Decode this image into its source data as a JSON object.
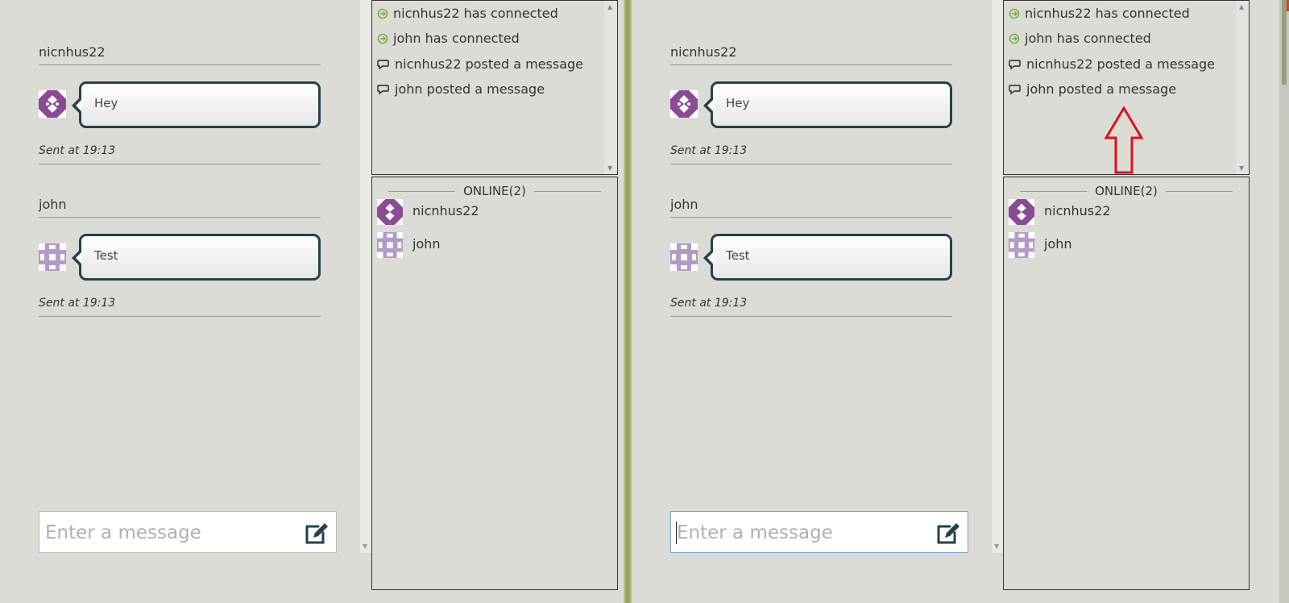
{
  "panes": [
    {
      "messages": [
        {
          "user": "nicnhus22",
          "text": "Hey",
          "sent": "Sent at 19:13"
        },
        {
          "user": "john",
          "text": "Test",
          "sent": "Sent at 19:13"
        }
      ],
      "input_placeholder": "Enter a message",
      "activity": [
        {
          "icon": "connect-icon",
          "text": "nicnhus22 has connected"
        },
        {
          "icon": "connect-icon",
          "text": "john has connected"
        },
        {
          "icon": "chat-bubble-icon",
          "text": "nicnhus22 posted a message"
        },
        {
          "icon": "chat-bubble-icon",
          "text": "john posted a message"
        }
      ],
      "online_title": "ONLINE(2)",
      "online_users": [
        "nicnhus22",
        "john"
      ]
    },
    {
      "messages": [
        {
          "user": "nicnhus22",
          "text": "Hey",
          "sent": "Sent at 19:13"
        },
        {
          "user": "john",
          "text": "Test",
          "sent": "Sent at 19:13"
        }
      ],
      "input_placeholder": "Enter a message",
      "activity": [
        {
          "icon": "connect-icon",
          "text": "nicnhus22 has connected"
        },
        {
          "icon": "connect-icon",
          "text": "john has connected"
        },
        {
          "icon": "chat-bubble-icon",
          "text": "nicnhus22 posted a message"
        },
        {
          "icon": "chat-bubble-icon",
          "text": "john posted a message"
        }
      ],
      "online_title": "ONLINE(2)",
      "online_users": [
        "nicnhus22",
        "john"
      ]
    }
  ],
  "colors": {
    "accent_dark": "#24424a",
    "connect_green": "#7ab040",
    "avatar_purple": "#8a4a96",
    "avatar_lilac": "#b39ac8",
    "annotation_red": "#e0101a"
  }
}
